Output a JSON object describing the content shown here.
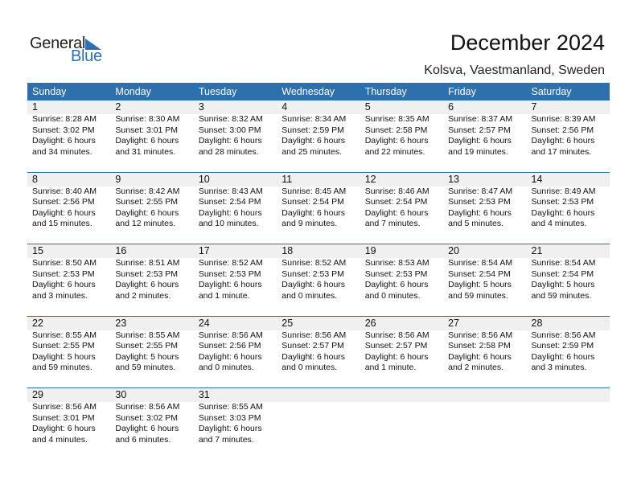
{
  "brand": {
    "part1": "General",
    "part2": "Blue"
  },
  "title": "December 2024",
  "location": "Kolsva, Vaestmanland, Sweden",
  "colors": {
    "accent": "#2e6fae",
    "date_strip": "#f0f0f0"
  },
  "weekdays": [
    "Sunday",
    "Monday",
    "Tuesday",
    "Wednesday",
    "Thursday",
    "Friday",
    "Saturday"
  ],
  "weeks": [
    [
      {
        "day": "1",
        "sunrise": "Sunrise: 8:28 AM",
        "sunset": "Sunset: 3:02 PM",
        "daylight1": "Daylight: 6 hours",
        "daylight2": "and 34 minutes."
      },
      {
        "day": "2",
        "sunrise": "Sunrise: 8:30 AM",
        "sunset": "Sunset: 3:01 PM",
        "daylight1": "Daylight: 6 hours",
        "daylight2": "and 31 minutes."
      },
      {
        "day": "3",
        "sunrise": "Sunrise: 8:32 AM",
        "sunset": "Sunset: 3:00 PM",
        "daylight1": "Daylight: 6 hours",
        "daylight2": "and 28 minutes."
      },
      {
        "day": "4",
        "sunrise": "Sunrise: 8:34 AM",
        "sunset": "Sunset: 2:59 PM",
        "daylight1": "Daylight: 6 hours",
        "daylight2": "and 25 minutes."
      },
      {
        "day": "5",
        "sunrise": "Sunrise: 8:35 AM",
        "sunset": "Sunset: 2:58 PM",
        "daylight1": "Daylight: 6 hours",
        "daylight2": "and 22 minutes."
      },
      {
        "day": "6",
        "sunrise": "Sunrise: 8:37 AM",
        "sunset": "Sunset: 2:57 PM",
        "daylight1": "Daylight: 6 hours",
        "daylight2": "and 19 minutes."
      },
      {
        "day": "7",
        "sunrise": "Sunrise: 8:39 AM",
        "sunset": "Sunset: 2:56 PM",
        "daylight1": "Daylight: 6 hours",
        "daylight2": "and 17 minutes."
      }
    ],
    [
      {
        "day": "8",
        "sunrise": "Sunrise: 8:40 AM",
        "sunset": "Sunset: 2:56 PM",
        "daylight1": "Daylight: 6 hours",
        "daylight2": "and 15 minutes."
      },
      {
        "day": "9",
        "sunrise": "Sunrise: 8:42 AM",
        "sunset": "Sunset: 2:55 PM",
        "daylight1": "Daylight: 6 hours",
        "daylight2": "and 12 minutes."
      },
      {
        "day": "10",
        "sunrise": "Sunrise: 8:43 AM",
        "sunset": "Sunset: 2:54 PM",
        "daylight1": "Daylight: 6 hours",
        "daylight2": "and 10 minutes."
      },
      {
        "day": "11",
        "sunrise": "Sunrise: 8:45 AM",
        "sunset": "Sunset: 2:54 PM",
        "daylight1": "Daylight: 6 hours",
        "daylight2": "and 9 minutes."
      },
      {
        "day": "12",
        "sunrise": "Sunrise: 8:46 AM",
        "sunset": "Sunset: 2:54 PM",
        "daylight1": "Daylight: 6 hours",
        "daylight2": "and 7 minutes."
      },
      {
        "day": "13",
        "sunrise": "Sunrise: 8:47 AM",
        "sunset": "Sunset: 2:53 PM",
        "daylight1": "Daylight: 6 hours",
        "daylight2": "and 5 minutes."
      },
      {
        "day": "14",
        "sunrise": "Sunrise: 8:49 AM",
        "sunset": "Sunset: 2:53 PM",
        "daylight1": "Daylight: 6 hours",
        "daylight2": "and 4 minutes."
      }
    ],
    [
      {
        "day": "15",
        "sunrise": "Sunrise: 8:50 AM",
        "sunset": "Sunset: 2:53 PM",
        "daylight1": "Daylight: 6 hours",
        "daylight2": "and 3 minutes."
      },
      {
        "day": "16",
        "sunrise": "Sunrise: 8:51 AM",
        "sunset": "Sunset: 2:53 PM",
        "daylight1": "Daylight: 6 hours",
        "daylight2": "and 2 minutes."
      },
      {
        "day": "17",
        "sunrise": "Sunrise: 8:52 AM",
        "sunset": "Sunset: 2:53 PM",
        "daylight1": "Daylight: 6 hours",
        "daylight2": "and 1 minute."
      },
      {
        "day": "18",
        "sunrise": "Sunrise: 8:52 AM",
        "sunset": "Sunset: 2:53 PM",
        "daylight1": "Daylight: 6 hours",
        "daylight2": "and 0 minutes."
      },
      {
        "day": "19",
        "sunrise": "Sunrise: 8:53 AM",
        "sunset": "Sunset: 2:53 PM",
        "daylight1": "Daylight: 6 hours",
        "daylight2": "and 0 minutes."
      },
      {
        "day": "20",
        "sunrise": "Sunrise: 8:54 AM",
        "sunset": "Sunset: 2:54 PM",
        "daylight1": "Daylight: 5 hours",
        "daylight2": "and 59 minutes."
      },
      {
        "day": "21",
        "sunrise": "Sunrise: 8:54 AM",
        "sunset": "Sunset: 2:54 PM",
        "daylight1": "Daylight: 5 hours",
        "daylight2": "and 59 minutes."
      }
    ],
    [
      {
        "day": "22",
        "sunrise": "Sunrise: 8:55 AM",
        "sunset": "Sunset: 2:55 PM",
        "daylight1": "Daylight: 5 hours",
        "daylight2": "and 59 minutes."
      },
      {
        "day": "23",
        "sunrise": "Sunrise: 8:55 AM",
        "sunset": "Sunset: 2:55 PM",
        "daylight1": "Daylight: 5 hours",
        "daylight2": "and 59 minutes."
      },
      {
        "day": "24",
        "sunrise": "Sunrise: 8:56 AM",
        "sunset": "Sunset: 2:56 PM",
        "daylight1": "Daylight: 6 hours",
        "daylight2": "and 0 minutes."
      },
      {
        "day": "25",
        "sunrise": "Sunrise: 8:56 AM",
        "sunset": "Sunset: 2:57 PM",
        "daylight1": "Daylight: 6 hours",
        "daylight2": "and 0 minutes."
      },
      {
        "day": "26",
        "sunrise": "Sunrise: 8:56 AM",
        "sunset": "Sunset: 2:57 PM",
        "daylight1": "Daylight: 6 hours",
        "daylight2": "and 1 minute."
      },
      {
        "day": "27",
        "sunrise": "Sunrise: 8:56 AM",
        "sunset": "Sunset: 2:58 PM",
        "daylight1": "Daylight: 6 hours",
        "daylight2": "and 2 minutes."
      },
      {
        "day": "28",
        "sunrise": "Sunrise: 8:56 AM",
        "sunset": "Sunset: 2:59 PM",
        "daylight1": "Daylight: 6 hours",
        "daylight2": "and 3 minutes."
      }
    ],
    [
      {
        "day": "29",
        "sunrise": "Sunrise: 8:56 AM",
        "sunset": "Sunset: 3:01 PM",
        "daylight1": "Daylight: 6 hours",
        "daylight2": "and 4 minutes."
      },
      {
        "day": "30",
        "sunrise": "Sunrise: 8:56 AM",
        "sunset": "Sunset: 3:02 PM",
        "daylight1": "Daylight: 6 hours",
        "daylight2": "and 6 minutes."
      },
      {
        "day": "31",
        "sunrise": "Sunrise: 8:55 AM",
        "sunset": "Sunset: 3:03 PM",
        "daylight1": "Daylight: 6 hours",
        "daylight2": "and 7 minutes."
      }
    ]
  ]
}
